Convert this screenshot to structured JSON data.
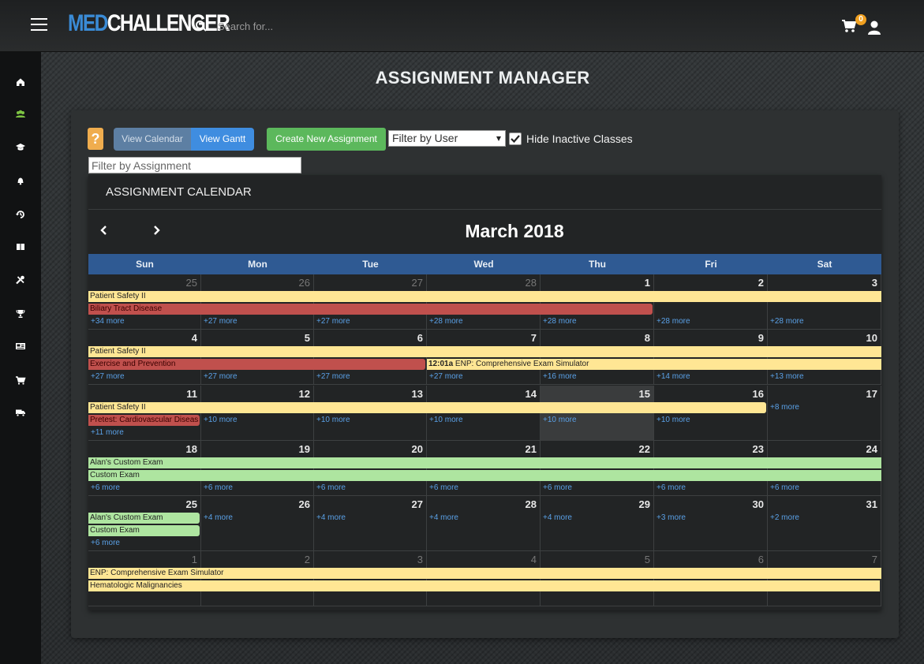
{
  "header": {
    "logo_part1": "MED",
    "logo_part2": "CHALLENGER",
    "search_placeholder": "Search for...",
    "cart_count": "0"
  },
  "sidebar": {
    "items": [
      {
        "icon": "home-icon"
      },
      {
        "icon": "users-icon"
      },
      {
        "icon": "graduation-cap-icon"
      },
      {
        "icon": "bell-icon"
      },
      {
        "icon": "history-icon"
      },
      {
        "icon": "book-icon"
      },
      {
        "icon": "tools-icon"
      },
      {
        "icon": "trophy-icon"
      },
      {
        "icon": "newspaper-icon"
      },
      {
        "icon": "cart-icon"
      },
      {
        "icon": "truck-icon"
      }
    ],
    "active_color": "#7cc242"
  },
  "page": {
    "title": "ASSIGNMENT MANAGER"
  },
  "toolbar": {
    "help_label": "?",
    "view_calendar_label": "View Calendar",
    "view_gantt_label": "View Gantt",
    "create_label": "Create New Assignment",
    "filter_user_value": "Filter by User",
    "hide_inactive_label": "Hide Inactive Classes",
    "hide_inactive_checked": true,
    "filter_assignment_placeholder": "Filter by Assignment"
  },
  "calendar": {
    "section_title": "ASSIGNMENT CALENDAR",
    "month_title": "March 2018",
    "days_of_week": [
      "Sun",
      "Mon",
      "Tue",
      "Wed",
      "Thu",
      "Fri",
      "Sat"
    ],
    "weeks": [
      {
        "days": [
          {
            "num": "25",
            "other": true,
            "more": "+34 more"
          },
          {
            "num": "26",
            "other": true,
            "more": "+27 more"
          },
          {
            "num": "27",
            "other": true,
            "more": "+27 more"
          },
          {
            "num": "28",
            "other": true,
            "more": "+28 more"
          },
          {
            "num": "1",
            "more": "+28 more"
          },
          {
            "num": "2",
            "more": "+28 more"
          },
          {
            "num": "3",
            "more": "+28 more"
          }
        ],
        "events": [
          {
            "label": "Patient Safety II",
            "color": "yellow",
            "start": 0,
            "end": 7,
            "row": 0
          },
          {
            "label": "Biliary Tract Disease",
            "color": "red",
            "start": 0,
            "end": 5,
            "row": 1
          }
        ],
        "more_row": 2
      },
      {
        "days": [
          {
            "num": "4",
            "more": "+27 more"
          },
          {
            "num": "5",
            "more": "+27 more"
          },
          {
            "num": "6",
            "more": "+27 more"
          },
          {
            "num": "7",
            "more": "+27 more"
          },
          {
            "num": "8",
            "more": "+16 more"
          },
          {
            "num": "9",
            "more": "+14 more"
          },
          {
            "num": "10",
            "more": "+13 more"
          }
        ],
        "events": [
          {
            "label": "Patient Safety II",
            "color": "yellow",
            "start": 0,
            "end": 7,
            "row": 0
          },
          {
            "label": "Exercise and Prevention",
            "color": "red",
            "start": 0,
            "end": 3,
            "row": 1
          },
          {
            "time": "12:01a",
            "label": "ENP: Comprehensive Exam Simulator",
            "color": "yellow",
            "start": 3,
            "end": 7,
            "row": 1
          }
        ],
        "more_row": 2
      },
      {
        "days": [
          {
            "num": "11",
            "more": "+11 more"
          },
          {
            "num": "12",
            "more": "+10 more"
          },
          {
            "num": "13",
            "more": "+10 more"
          },
          {
            "num": "14",
            "more": "+10 more"
          },
          {
            "num": "15",
            "today": true,
            "more": "+10 more"
          },
          {
            "num": "16",
            "more": "+10 more"
          },
          {
            "num": "17",
            "more": "+8 more"
          }
        ],
        "events": [
          {
            "label": "Patient Safety II",
            "color": "yellow",
            "start": 0,
            "end": 6,
            "row": 0
          },
          {
            "label": "Pretest: Cardiovascular Diseas",
            "color": "red",
            "start": 0,
            "end": 1,
            "row": 1
          }
        ],
        "more_rows": [
          2,
          1,
          1,
          1,
          1,
          1,
          0
        ]
      },
      {
        "days": [
          {
            "num": "18",
            "more": "+6 more"
          },
          {
            "num": "19",
            "more": "+6 more"
          },
          {
            "num": "20",
            "more": "+6 more"
          },
          {
            "num": "21",
            "more": "+6 more"
          },
          {
            "num": "22",
            "more": "+6 more"
          },
          {
            "num": "23",
            "more": "+6 more"
          },
          {
            "num": "24",
            "more": "+6 more"
          }
        ],
        "events": [
          {
            "label": "Alan's Custom Exam",
            "color": "green",
            "start": 0,
            "end": 7,
            "row": 0
          },
          {
            "label": "Custom Exam",
            "color": "green",
            "start": 0,
            "end": 7,
            "row": 1
          }
        ],
        "more_row": 2
      },
      {
        "days": [
          {
            "num": "25",
            "more": "+6 more"
          },
          {
            "num": "26",
            "more": "+4 more"
          },
          {
            "num": "27",
            "more": "+4 more"
          },
          {
            "num": "28",
            "more": "+4 more"
          },
          {
            "num": "29",
            "more": "+4 more"
          },
          {
            "num": "30",
            "more": "+3 more"
          },
          {
            "num": "31",
            "more": "+2 more"
          }
        ],
        "events": [
          {
            "label": "Alan's Custom Exam",
            "color": "green",
            "start": 0,
            "end": 1,
            "row": 0
          },
          {
            "label": "Custom Exam",
            "color": "green",
            "start": 0,
            "end": 1,
            "row": 1
          }
        ],
        "more_rows": [
          2,
          0,
          0,
          0,
          0,
          0,
          0
        ]
      },
      {
        "days": [
          {
            "num": "1",
            "other": true
          },
          {
            "num": "2",
            "other": true
          },
          {
            "num": "3",
            "other": true
          },
          {
            "num": "4",
            "other": true
          },
          {
            "num": "5",
            "other": true
          },
          {
            "num": "6",
            "other": true
          },
          {
            "num": "7",
            "other": true
          }
        ],
        "events": [
          {
            "label": "ENP: Comprehensive Exam Simulator",
            "color": "yellow",
            "start": 0,
            "end": 7,
            "row": 0
          },
          {
            "label": "Hematologic Malignancies",
            "color": "yellow",
            "start": 0,
            "end": 7,
            "row": 1
          }
        ]
      }
    ]
  }
}
